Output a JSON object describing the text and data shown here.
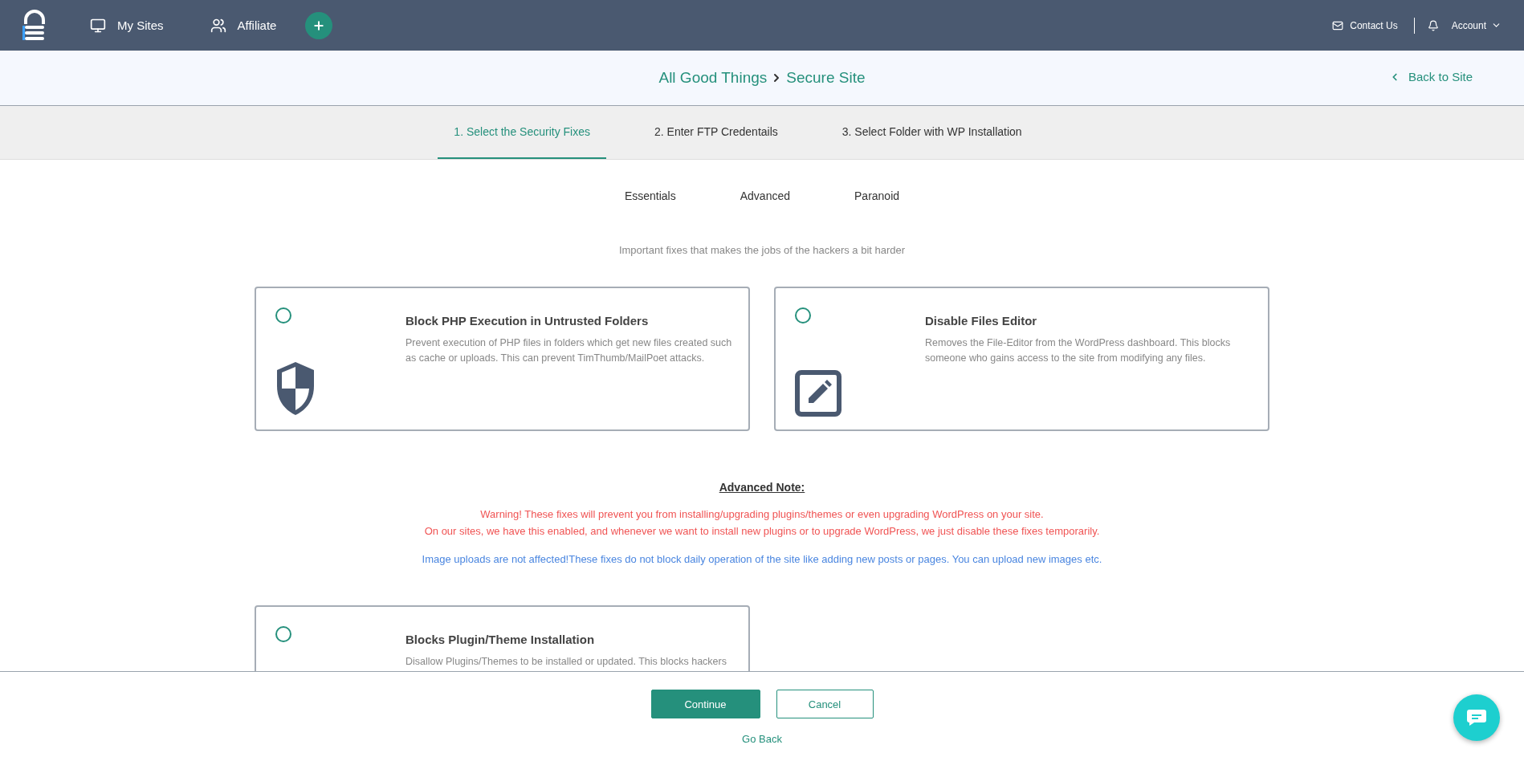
{
  "nav": {
    "items": [
      {
        "label": "My Sites"
      },
      {
        "label": "Affiliate"
      }
    ],
    "contact": "Contact Us",
    "account": "Account"
  },
  "breadcrumb": {
    "site": "All Good Things",
    "page": "Secure Site",
    "back": "Back to Site"
  },
  "steps": [
    {
      "label": "1. Select the Security Fixes",
      "selected": true
    },
    {
      "label": "2. Enter FTP Credentails",
      "selected": false
    },
    {
      "label": "3. Select Folder with WP Installation",
      "selected": false
    }
  ],
  "levels": [
    "Essentials",
    "Advanced",
    "Paranoid"
  ],
  "subtitle": "Important fixes that makes the jobs of the hackers a bit harder",
  "fixes": [
    {
      "title": "Block PHP Execution in Untrusted Folders",
      "description": "Prevent execution of PHP files in folders which get new files created such as cache or uploads. This can prevent TimThumb/MailPoet attacks.",
      "checked": false
    },
    {
      "title": "Disable Files Editor",
      "description": "Removes the File-Editor from the WordPress dashboard. This blocks someone who gains access to the site from modifying any files.",
      "checked": false
    }
  ],
  "note": {
    "heading": "Advanced Note:",
    "warnings": [
      "Warning! These fixes will prevent you from installing/upgrading plugins/themes or even upgrading WordPress on your site.",
      "On our sites, we have this enabled, and whenever we want to install new plugins or to upgrade WordPress, we just disable these fixes temporarily."
    ],
    "info": "Image uploads are not affected!These fixes do not block daily operation of the site like adding new posts or pages. You can upload new images etc."
  },
  "advanced_fixes": [
    {
      "title": "Blocks Plugin/Theme Installation",
      "description": "Disallow Plugins/Themes to be installed or updated. This blocks hackers",
      "checked": false
    }
  ],
  "footer": {
    "primary": "Continue",
    "secondary": "Cancel",
    "back": "Go Back"
  }
}
